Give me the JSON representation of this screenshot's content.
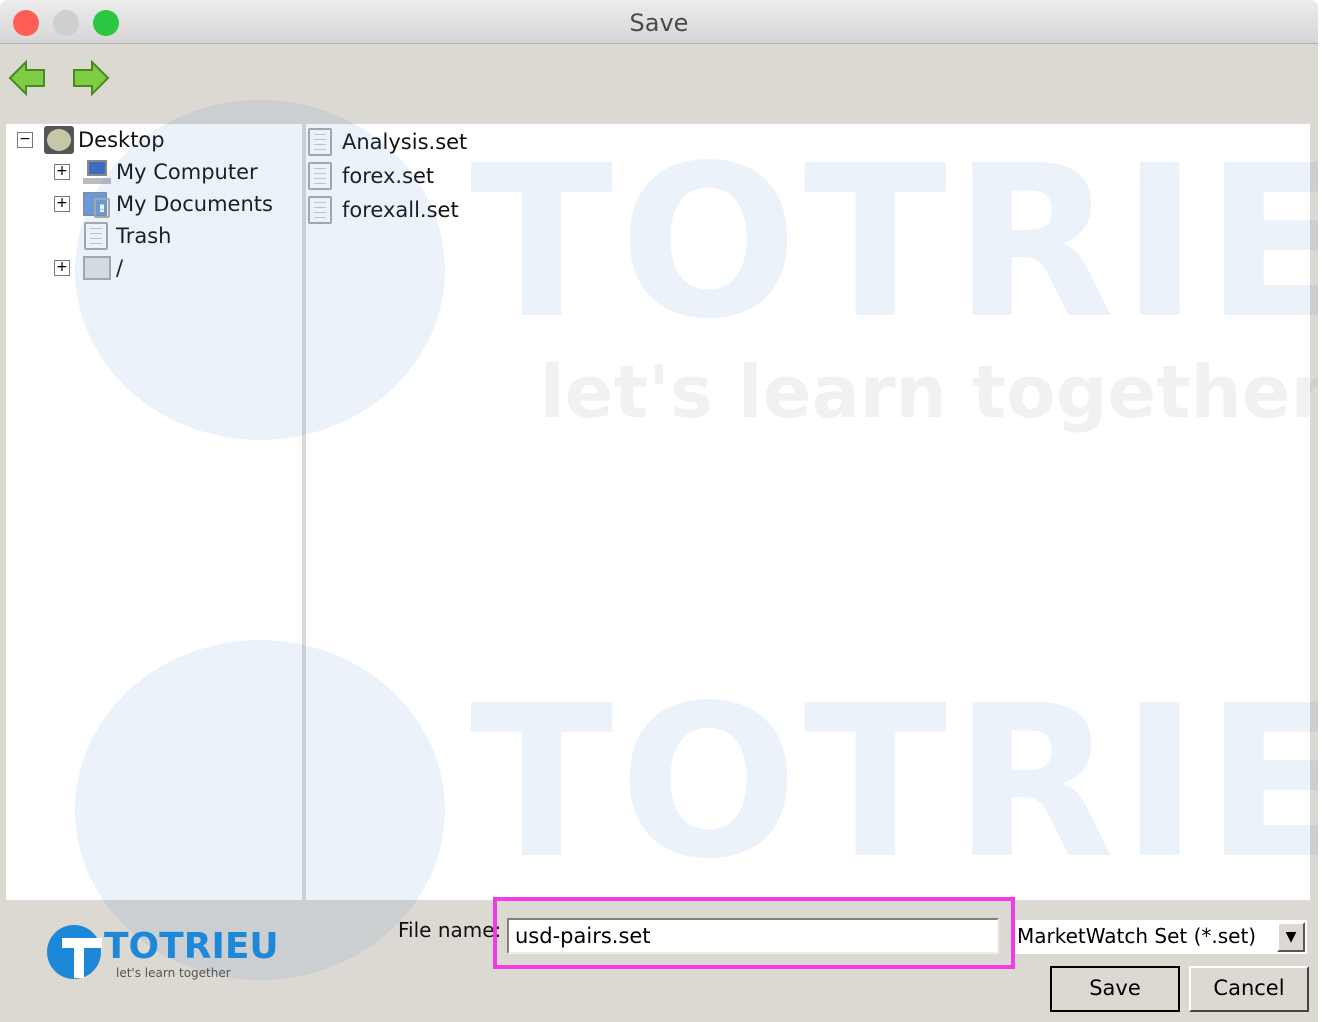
{
  "window": {
    "title": "Save"
  },
  "toolbar": {
    "back_icon": "green-left-arrow",
    "forward_icon": "green-right-arrow"
  },
  "tree": {
    "items": [
      {
        "label": "Desktop",
        "icon": "desktop-icon",
        "expander": "−"
      },
      {
        "label": "My Computer",
        "icon": "computer-icon",
        "expander": "+"
      },
      {
        "label": "My Documents",
        "icon": "documents-folder-icon",
        "expander": "+"
      },
      {
        "label": "Trash",
        "icon": "trash-icon"
      },
      {
        "label": "/",
        "icon": "drive-icon",
        "expander": "+"
      }
    ]
  },
  "files": {
    "items": [
      {
        "label": "Analysis.set"
      },
      {
        "label": "forex.set"
      },
      {
        "label": "forexall.set"
      }
    ]
  },
  "form": {
    "file_name_label": "File name:",
    "file_name_value": "usd-pairs.set",
    "file_type": "MarketWatch Set (*.set)",
    "save_label": "Save",
    "cancel_label": "Cancel"
  },
  "watermark": {
    "brand": "TOTRIEU",
    "tagline": "let's learn together"
  },
  "colors": {
    "highlight": "#f03ce6",
    "nav_arrow": "#6cc03a"
  }
}
